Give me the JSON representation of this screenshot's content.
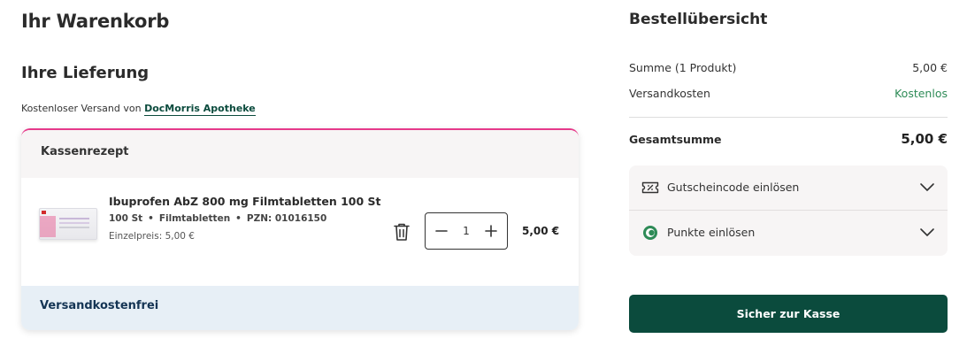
{
  "cart": {
    "title": "Ihr Warenkorb",
    "delivery_title": "Ihre Lieferung",
    "shipping_prefix": "Kostenloser Versand von",
    "pharmacy_name": "DocMorris Apotheke",
    "group_title": "Kassenrezept",
    "footer_text": "Versandkostenfrei",
    "items": [
      {
        "name": "Ibuprofen AbZ 800 mg Filmtabletten 100 St",
        "quantity_label": "100 St",
        "form": "Filmtabletten",
        "pzn": "PZN: 01016150",
        "unit_price": "Einzelpreis: 5,00 €",
        "quantity": "1",
        "price": "5,00 €"
      }
    ]
  },
  "summary": {
    "title": "Bestellübersicht",
    "subtotal_label": "Summe (1 Produkt)",
    "subtotal_value": "5,00 €",
    "shipping_label": "Versandkosten",
    "shipping_value": "Kostenlos",
    "total_label": "Gesamtsumme",
    "total_value": "5,00 €",
    "voucher_label": "Gutscheincode einlösen",
    "points_label": "Punkte einlösen",
    "checkout_label": "Sicher zur Kasse"
  },
  "colors": {
    "brand_green": "#0b4b3d",
    "accent_pink": "#e6398a",
    "free_green": "#2e8b57",
    "footer_blue": "#e7eff6"
  },
  "icons": {
    "trash": "trash-icon",
    "minus": "minus-icon",
    "plus": "plus-icon",
    "voucher": "voucher-icon",
    "points": "points-icon",
    "chevron": "chevron-down-icon"
  }
}
